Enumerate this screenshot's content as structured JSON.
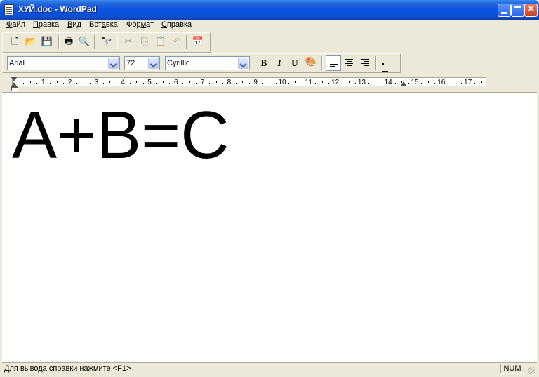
{
  "window": {
    "title": "ХУЙ.doc - WordPad"
  },
  "menu": [
    {
      "pre": "",
      "ul": "Ф",
      "post": "айл"
    },
    {
      "pre": "",
      "ul": "П",
      "post": "равка"
    },
    {
      "pre": "",
      "ul": "В",
      "post": "ид"
    },
    {
      "pre": "Вст",
      "ul": "а",
      "post": "вка"
    },
    {
      "pre": "Фор",
      "ul": "м",
      "post": "ат"
    },
    {
      "pre": "",
      "ul": "С",
      "post": "правка"
    }
  ],
  "toolbar": {
    "icons": [
      "new-icon",
      "open-icon",
      "save-icon",
      "print-icon",
      "print-preview-icon",
      "find-icon",
      "cut-icon",
      "copy-icon",
      "paste-icon",
      "undo-icon",
      "insert-datetime-icon"
    ]
  },
  "format": {
    "font": "Arial",
    "size": "72",
    "script": "Cyrillic",
    "bold": "B",
    "italic": "I",
    "underline": "U",
    "alignment": "left"
  },
  "ruler": {
    "numbers": [
      "1",
      "2",
      "3",
      "4",
      "5",
      "6",
      "7",
      "8",
      "9",
      "10",
      "11",
      "12",
      "13",
      "14",
      "15",
      "16",
      "17"
    ]
  },
  "document": {
    "text": "A+B=C"
  },
  "status": {
    "message": "Для вывода справки нажмите <F1>",
    "num": "NUM"
  }
}
